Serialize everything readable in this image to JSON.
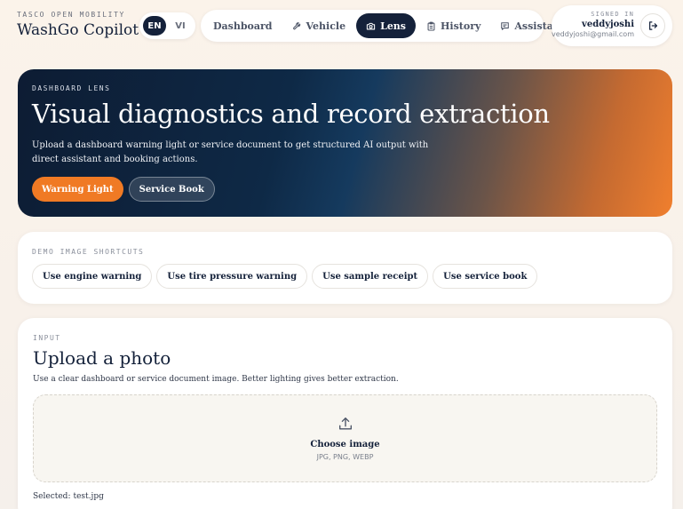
{
  "brand": {
    "eyebrow": "TASCO OPEN MOBILITY",
    "title": "WashGo Copilot"
  },
  "language": {
    "options": [
      "EN",
      "VI"
    ],
    "selected": "EN"
  },
  "nav": {
    "items": [
      {
        "label": "Dashboard",
        "icon": ""
      },
      {
        "label": "Vehicle",
        "icon": "wrench-icon"
      },
      {
        "label": "Lens",
        "icon": "camera-icon",
        "active": true
      },
      {
        "label": "History",
        "icon": "clipboard-icon"
      },
      {
        "label": "Assistant",
        "icon": "chat-icon"
      }
    ]
  },
  "account": {
    "eyebrow": "SIGNED IN",
    "name": "veddyjoshi",
    "email": "veddyjoshi@gmail.com",
    "logout_icon": "logout-icon"
  },
  "hero": {
    "eyebrow": "DASHBOARD LENS",
    "title": "Visual diagnostics and record extraction",
    "description": "Upload a dashboard warning light or service document to get structured AI output with direct assistant and booking actions.",
    "actions": {
      "primary": "Warning Light",
      "secondary": "Service Book"
    },
    "colors": {
      "accent": "#f07a24",
      "dark": "#0d1c33"
    }
  },
  "shortcuts": {
    "eyebrow": "DEMO IMAGE SHORTCUTS",
    "items": [
      "Use engine warning",
      "Use tire pressure warning",
      "Use sample receipt",
      "Use service book"
    ]
  },
  "input": {
    "eyebrow": "INPUT",
    "title": "Upload a photo",
    "description": "Use a clear dashboard or service document image. Better lighting gives better extraction.",
    "dropzone": {
      "icon": "upload-icon",
      "label": "Choose image",
      "hint": "JPG, PNG, WEBP"
    },
    "selected_label": "Selected:",
    "selected_file": "test.jpg"
  }
}
